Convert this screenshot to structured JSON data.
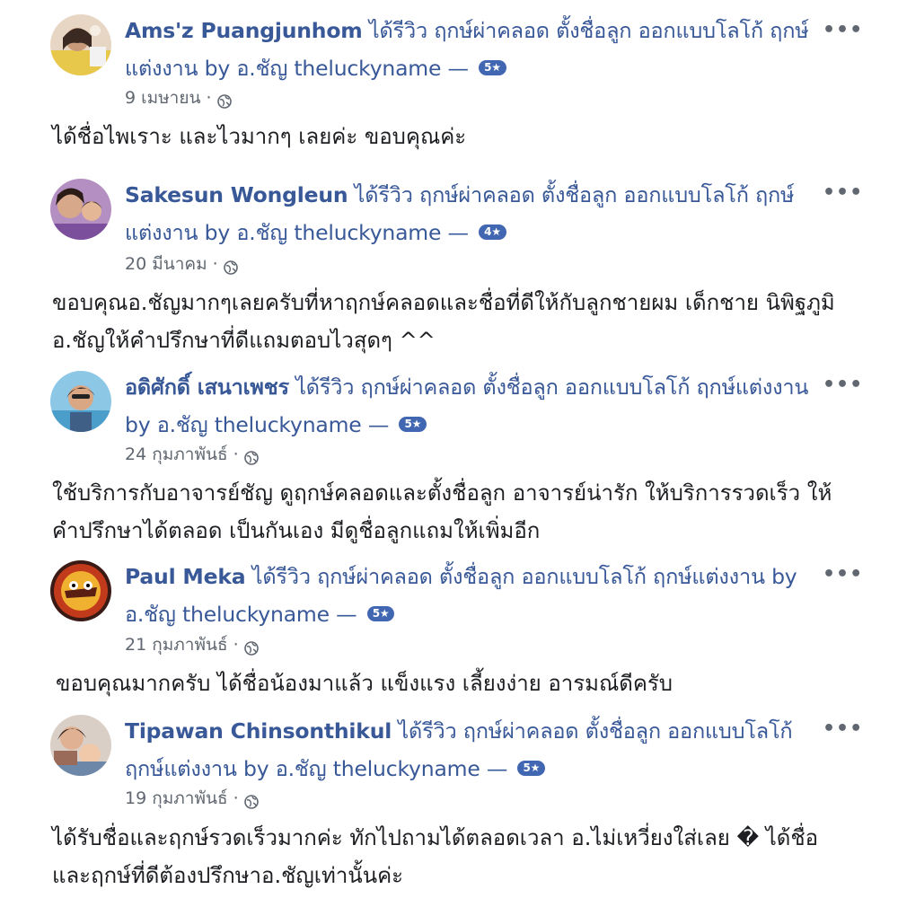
{
  "reviews": [
    {
      "reviewer": "Ams'z Puangjunhom",
      "action": "ได้รีวิว ฤกษ์ผ่าคลอด ตั้งชื่อลูก ออกแบบโลโก้ ฤกษ์แต่งงาน by อ.ชัญ theluckyname",
      "dash": "—",
      "rating": "5★",
      "date": "9 เมษายน",
      "privacy_icon": "globe-icon",
      "more_label": "•••",
      "text": "ได้ชื่อไพเราะ และไวมากๆ เลยค่ะ ขอบคุณค่ะ"
    },
    {
      "reviewer": "Sakesun Wongleun",
      "action": "ได้รีวิว ฤกษ์ผ่าคลอด ตั้งชื่อลูก ออกแบบโลโก้ ฤกษ์แต่งงาน by อ.ชัญ theluckyname",
      "dash": "—",
      "rating": "4★",
      "date": "20 มีนาคม",
      "privacy_icon": "globe-icon",
      "more_label": "•••",
      "text": "ขอบคุณอ.ชัญมากๆเลยครับที่หาฤกษ์คลอดและชื่อที่ดีให้กับลูกชายผม เด็กชาย นิพิฐภูมิ อ.ชัญให้คำปรึกษาที่ดีแถมตอบไวสุดๆ ^^"
    },
    {
      "reviewer": "อดิศักดิ์ เสนาเพชร",
      "action": "ได้รีวิว ฤกษ์ผ่าคลอด ตั้งชื่อลูก ออกแบบโลโก้ ฤกษ์แต่งงาน by อ.ชัญ theluckyname",
      "dash": "—",
      "rating": "5★",
      "date": "24 กุมภาพันธ์",
      "privacy_icon": "globe-icon",
      "more_label": "•••",
      "text": "ใช้บริการกับอาจารย์ชัญ ดูฤกษ์คลอดและตั้งชื่อลูก อาจารย์น่ารัก ให้บริการรวดเร็ว ให้คำปรึกษาได้ตลอด เป็นกันเอง มีดูชื่อลูกแถมให้เพิ่มอีก"
    },
    {
      "reviewer": "Paul Meka",
      "action": "ได้รีวิว ฤกษ์ผ่าคลอด ตั้งชื่อลูก ออกแบบโลโก้ ฤกษ์แต่งงาน by อ.ชัญ theluckyname",
      "dash": "—",
      "rating": "5★",
      "date": "21 กุมภาพันธ์",
      "privacy_icon": "globe-icon",
      "more_label": "•••",
      "text": "ขอบคุณมากครับ ได้ชื่อน้องมาแล้ว แข็งแรง เลี้ยงง่าย อารมณ์ดีครับ"
    },
    {
      "reviewer": "Tipawan Chinsonthikul",
      "action": "ได้รีวิว ฤกษ์ผ่าคลอด ตั้งชื่อลูก ออกแบบโลโก้ ฤกษ์แต่งงาน by อ.ชัญ theluckyname",
      "dash": "—",
      "rating": "5★",
      "date": "19 กุมภาพันธ์",
      "privacy_icon": "globe-icon",
      "more_label": "•••",
      "text": "ได้รับชื่อและฤกษ์รวดเร็วมากค่ะ ทักไปถามได้ตลอดเวลา อ.ไม่เหวี่ยงใส่เลย � ได้ชื่อและฤกษ์ที่ดีต้องปรึกษาอ.ชัญเท่านั้นค่ะ"
    }
  ],
  "colors": {
    "link": "#385898",
    "badge": "#4267b2",
    "meta": "#606770",
    "text": "#1c1e21"
  }
}
